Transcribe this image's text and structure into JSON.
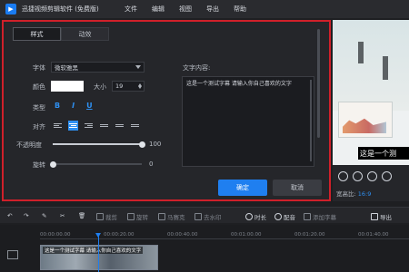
{
  "app": {
    "title": "迅捷视频剪辑软件 (免费版)",
    "logo_glyph": "▶",
    "menu": [
      "文件",
      "编辑",
      "视图",
      "导出",
      "帮助"
    ]
  },
  "dialog": {
    "tabs": [
      {
        "label": "样式",
        "active": true
      },
      {
        "label": "动效",
        "active": false
      }
    ],
    "font_label": "字体",
    "font_value": "微软雅黑",
    "color_label": "颜色",
    "color_value": "#ffffff",
    "size_label": "大小",
    "size_value": "19",
    "type_label": "类型",
    "type_buttons": [
      "B",
      "I",
      "U"
    ],
    "align_label": "对齐",
    "opacity_label": "不透明度",
    "opacity_value": "100",
    "opacity_fraction": 1.0,
    "rotate_label": "旋转",
    "rotate_value": "0",
    "rotate_fraction": 0.0,
    "text_content_label": "文字内容:",
    "text_content": "这是一个测试字幕 请输入你自己喜欢的文字",
    "confirm_label": "确定",
    "cancel_label": "取消",
    "accent_color": "#1f7ff0",
    "highlight_border": "#d0202a"
  },
  "preview": {
    "subtitle_text": "这是一个测",
    "ratio_label": "宽高比:",
    "ratio_value": "16:9"
  },
  "toolbar": {
    "items": [
      "撤销",
      "重做",
      "编辑",
      "剪切",
      "删除",
      "裁剪",
      "旋转",
      "马赛克",
      "去水印",
      "时长",
      "配音",
      "添加字幕",
      "导出"
    ],
    "duration_label": "时长",
    "dub_label": "配音",
    "export_label": "导出"
  },
  "timeline": {
    "ticks": [
      "00:00:00.00",
      "00:00:20.00",
      "00:00:40.00",
      "00:01:00.00",
      "00:01:20.00",
      "00:01:40.00"
    ],
    "clip_label": "这是一个测试字幕 请输入你自己喜欢的文字"
  }
}
